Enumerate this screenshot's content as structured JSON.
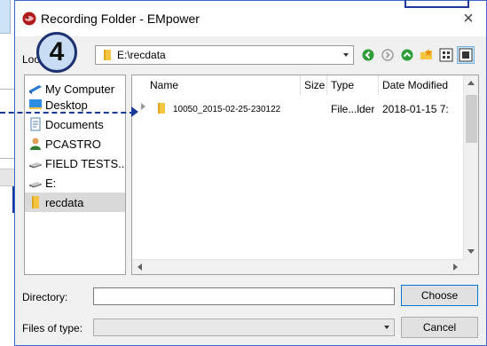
{
  "window": {
    "title": "Recording Folder - EMpower",
    "close_glyph": "×"
  },
  "callout": {
    "step_number": "4"
  },
  "toolbar": {
    "look_in_label": "Loo",
    "look_in_value": "E:\\recdata",
    "buttons": [
      "back-icon",
      "forward-icon",
      "up-folder-icon",
      "new-folder-icon",
      "list-view-icon",
      "details-view-icon"
    ]
  },
  "sidebar": {
    "items": [
      {
        "label": "My Computer",
        "icon": "computer-icon"
      },
      {
        "label": "Desktop",
        "icon": "desktop-icon"
      },
      {
        "label": "Documents",
        "icon": "documents-icon"
      },
      {
        "label": "PCASTRO",
        "icon": "user-icon"
      },
      {
        "label": "FIELD TESTS...",
        "icon": "drive-icon"
      },
      {
        "label": "E:",
        "icon": "drive-icon"
      },
      {
        "label": "recdata",
        "icon": "folder-icon",
        "selected": true
      }
    ]
  },
  "table": {
    "columns": [
      "Name",
      "Size",
      "Type",
      "Date Modified"
    ],
    "rows": [
      {
        "name": "10050_2015-02-25-230122",
        "size": "",
        "type": "File...lder",
        "date": "2018-01-15 7:"
      }
    ]
  },
  "form": {
    "directory_label": "Directory:",
    "directory_value": "",
    "files_of_type_label": "Files of type:",
    "files_of_type_value": "",
    "choose_label": "Choose",
    "cancel_label": "Cancel"
  },
  "colors": {
    "accent": "#0078d7",
    "callout": "#1a3a9a",
    "folder": "#f5c542",
    "dialog_bg": "#f0f0f0"
  }
}
